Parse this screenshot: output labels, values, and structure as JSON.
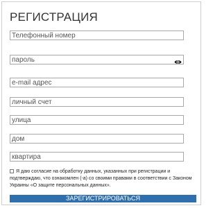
{
  "form": {
    "title": "РЕГИСТРАЦИЯ",
    "phone_placeholder": "Телефонный номер",
    "password_placeholder": "пароль",
    "email_placeholder": "e-mail адрес",
    "account_placeholder": "личный счет",
    "street_placeholder": "улица",
    "house_placeholder": "дом",
    "apartment_placeholder": "квартира",
    "consent_text": "Я даю согласие на обработку данных, указанных при регистрации и подтверждаю, что ознакомлен (-а) со своими правами в соответствии с Законом Украины «О защите персональных данных».",
    "submit_label": "ЗАРЕГИСТРИРОВАТЬСЯ"
  },
  "icons": {
    "password_toggle": "eye-icon"
  },
  "colors": {
    "submit_background": "#2f6fae",
    "submit_text": "#ffffff",
    "field_border": "#a8a8a8",
    "title_text": "#333333"
  }
}
